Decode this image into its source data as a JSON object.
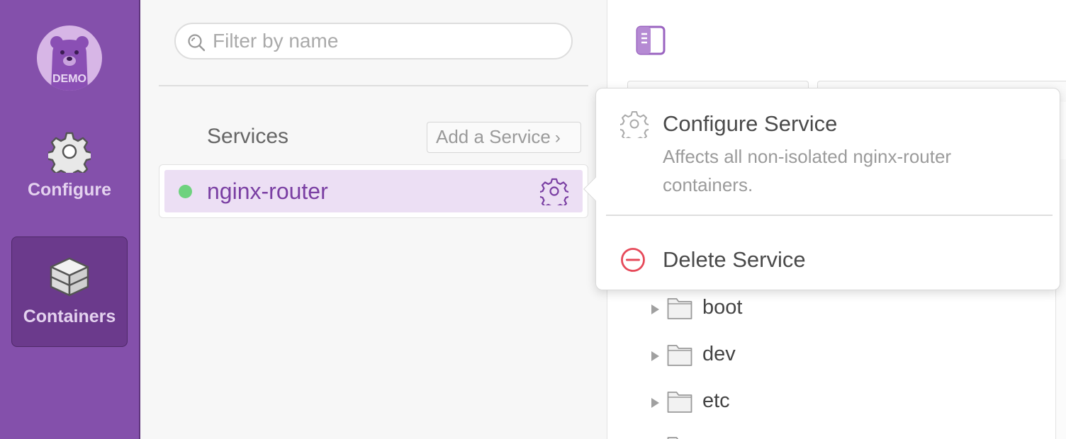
{
  "colors": {
    "sidebar": "#8450ab",
    "sidebar_active": "#6b3a8c",
    "service_selected": "#ecdff4",
    "service_text": "#7a3fa3",
    "status_running": "#6ed27e",
    "delete_red": "#e64a5a"
  },
  "sidebar": {
    "avatar": {
      "label": "DEMO",
      "icon": "bear-icon"
    },
    "items": [
      {
        "label": "Configure",
        "icon": "gear-icon",
        "active": false
      },
      {
        "label": "Containers",
        "icon": "box-icon",
        "active": true
      }
    ]
  },
  "search": {
    "placeholder": "Filter by name",
    "value": ""
  },
  "services": {
    "title": "Services",
    "add_label": "Add a Service",
    "items": [
      {
        "name": "nginx-router",
        "status": "running",
        "selected": true
      }
    ]
  },
  "popover": {
    "configure": {
      "title": "Configure Service",
      "description": "Affects all non-isolated nginx-router containers.",
      "icon": "gear-icon"
    },
    "delete": {
      "title": "Delete Service",
      "icon": "minus-circle-icon"
    }
  },
  "file_tree": [
    {
      "name": "boot",
      "icon": "folder-icon"
    },
    {
      "name": "dev",
      "icon": "folder-icon"
    },
    {
      "name": "etc",
      "icon": "folder-icon"
    }
  ]
}
